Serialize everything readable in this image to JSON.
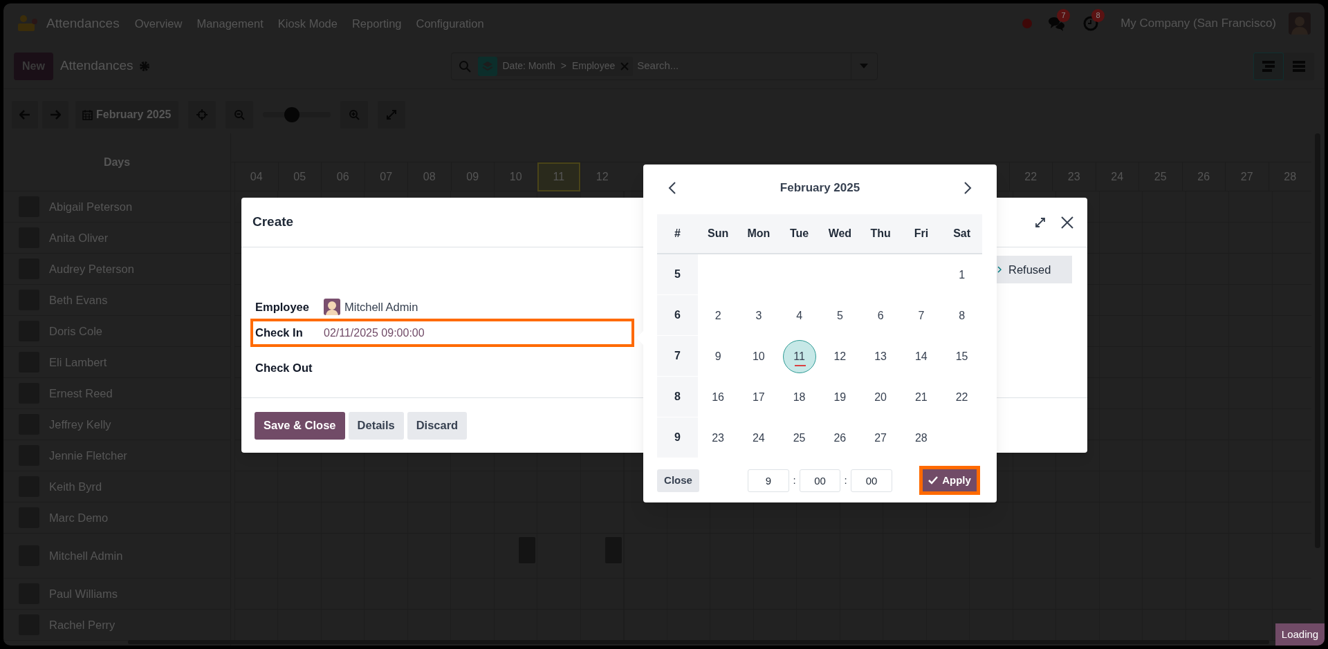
{
  "navbar": {
    "app_name": "Attendances",
    "menu": [
      "Overview",
      "Management",
      "Kiosk Mode",
      "Reporting",
      "Configuration"
    ],
    "messages_badge": "7",
    "activities_badge": "8",
    "company": "My Company (San Francisco)"
  },
  "control_panel": {
    "new_button": "New",
    "title": "Attendances",
    "search": {
      "facet_values": [
        "Date: Month",
        "Employee"
      ],
      "facet_separator": ">",
      "placeholder": "Search..."
    },
    "views": [
      {
        "kind": "gantt",
        "selected": true
      },
      {
        "kind": "list",
        "selected": false
      }
    ]
  },
  "toolbar": {
    "period": "February 2025",
    "zoom": {
      "level": 0.42
    }
  },
  "gantt": {
    "row_header": "Days",
    "days_left": [
      {
        "label": "04",
        "today": false
      },
      {
        "label": "05",
        "today": false
      },
      {
        "label": "06",
        "today": false
      },
      {
        "label": "07",
        "today": false
      },
      {
        "label": "08",
        "today": false
      },
      {
        "label": "09",
        "today": false
      },
      {
        "label": "10",
        "today": false
      },
      {
        "label": "11",
        "today": true
      },
      {
        "label": "12",
        "today": false
      }
    ],
    "days_right": [
      {
        "label": "22",
        "today": false
      },
      {
        "label": "23",
        "today": false
      },
      {
        "label": "24",
        "today": false
      },
      {
        "label": "25",
        "today": false
      },
      {
        "label": "26",
        "today": false
      },
      {
        "label": "27",
        "today": false
      },
      {
        "label": "28",
        "today": false
      }
    ],
    "employees": [
      {
        "name": "Abigail Peterson"
      },
      {
        "name": "Anita Oliver"
      },
      {
        "name": "Audrey Peterson"
      },
      {
        "name": "Beth Evans"
      },
      {
        "name": "Doris Cole"
      },
      {
        "name": "Eli Lambert"
      },
      {
        "name": "Ernest Reed"
      },
      {
        "name": "Jeffrey Kelly"
      },
      {
        "name": "Jennie Fletcher"
      },
      {
        "name": "Keith Byrd"
      },
      {
        "name": "Marc Demo"
      },
      {
        "name": "Mitchell Admin"
      },
      {
        "name": "Paul Williams"
      },
      {
        "name": "Rachel Perry"
      }
    ]
  },
  "dialog": {
    "title": "Create",
    "status": "Refused",
    "fields": [
      {
        "label": "Employee",
        "value": "Mitchell Admin",
        "kind": "avatar",
        "highlighted": false
      },
      {
        "label": "Check In",
        "value": "02/11/2025 09:00:00",
        "kind": "datetime",
        "highlighted": true
      },
      {
        "label": "Check Out",
        "kind": "datetime",
        "highlighted": false
      }
    ],
    "buttons": [
      {
        "label": "Save & Close",
        "kind": "primary"
      },
      {
        "label": "Details",
        "kind": "secondary"
      },
      {
        "label": "Discard",
        "kind": "secondary"
      }
    ]
  },
  "date_picker": {
    "month": "February 2025",
    "week_header": "#",
    "weekdays": [
      "Sun",
      "Mon",
      "Tue",
      "Wed",
      "Thu",
      "Fri",
      "Sat"
    ],
    "weeks": [
      {
        "number": "5",
        "days": [
          {
            "label": "1",
            "selected": false,
            "today": false
          }
        ]
      },
      {
        "number": "6",
        "days": [
          {
            "label": "2",
            "selected": false,
            "today": false
          },
          {
            "label": "3",
            "selected": false,
            "today": false
          },
          {
            "label": "4",
            "selected": false,
            "today": false
          },
          {
            "label": "5",
            "selected": false,
            "today": false
          },
          {
            "label": "6",
            "selected": false,
            "today": false
          },
          {
            "label": "7",
            "selected": false,
            "today": false
          },
          {
            "label": "8",
            "selected": false,
            "today": false
          }
        ]
      },
      {
        "number": "7",
        "days": [
          {
            "label": "9",
            "selected": false,
            "today": false
          },
          {
            "label": "10",
            "selected": false,
            "today": false
          },
          {
            "label": "11",
            "selected": true,
            "today": true
          },
          {
            "label": "12",
            "selected": false,
            "today": false
          },
          {
            "label": "13",
            "selected": false,
            "today": false
          },
          {
            "label": "14",
            "selected": false,
            "today": false
          },
          {
            "label": "15",
            "selected": false,
            "today": false
          }
        ]
      },
      {
        "number": "8",
        "days": [
          {
            "label": "16",
            "selected": false,
            "today": false
          },
          {
            "label": "17",
            "selected": false,
            "today": false
          },
          {
            "label": "18",
            "selected": false,
            "today": false
          },
          {
            "label": "19",
            "selected": false,
            "today": false
          },
          {
            "label": "20",
            "selected": false,
            "today": false
          },
          {
            "label": "21",
            "selected": false,
            "today": false
          },
          {
            "label": "22",
            "selected": false,
            "today": false
          }
        ]
      },
      {
        "number": "9",
        "days": [
          {
            "label": "23",
            "selected": false,
            "today": false
          },
          {
            "label": "24",
            "selected": false,
            "today": false
          },
          {
            "label": "25",
            "selected": false,
            "today": false
          },
          {
            "label": "26",
            "selected": false,
            "today": false
          },
          {
            "label": "27",
            "selected": false,
            "today": false
          },
          {
            "label": "28",
            "selected": false,
            "today": false
          }
        ]
      }
    ],
    "time": {
      "hours": "9",
      "minutes": "00",
      "seconds": "00",
      "separator": ":"
    },
    "close_button": "Close",
    "apply_button": {
      "label": "Apply",
      "highlighted": true
    }
  },
  "loading_indicator": "Loading"
}
